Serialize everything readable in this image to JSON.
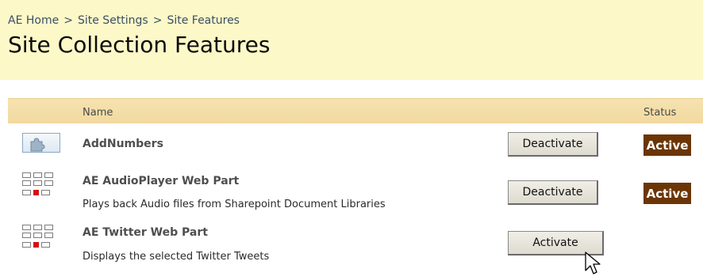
{
  "breadcrumb": {
    "items": [
      "AE Home",
      "Site Settings",
      "Site Features"
    ],
    "separator": ">"
  },
  "page_title": "Site Collection Features",
  "table": {
    "headers": {
      "name": "Name",
      "status": "Status"
    },
    "rows": [
      {
        "name": "AddNumbers",
        "description": "",
        "button_label": "Deactivate",
        "status": "Active",
        "icon": "puzzle-feature-icon"
      },
      {
        "name": "AE AudioPlayer Web Part",
        "description": "Plays back Audio files from Sharepoint Document Libraries",
        "button_label": "Deactivate",
        "status": "Active",
        "icon": "webpart-grid-icon"
      },
      {
        "name": "AE Twitter Web Part",
        "description": "Displays the selected Twitter Tweets",
        "button_label": "Activate",
        "status": "",
        "icon": "webpart-grid-icon"
      }
    ]
  },
  "colors": {
    "title_background": "#fdf8c8",
    "header_background": "#f3dba4",
    "active_badge": "#6b3506",
    "accent_red": "#d41111"
  }
}
